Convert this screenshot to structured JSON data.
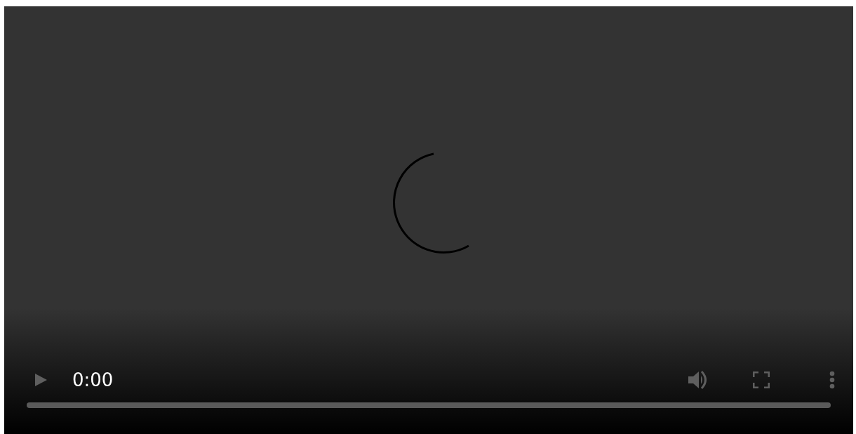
{
  "player": {
    "loading": true,
    "playing": false,
    "time": "0:00"
  }
}
